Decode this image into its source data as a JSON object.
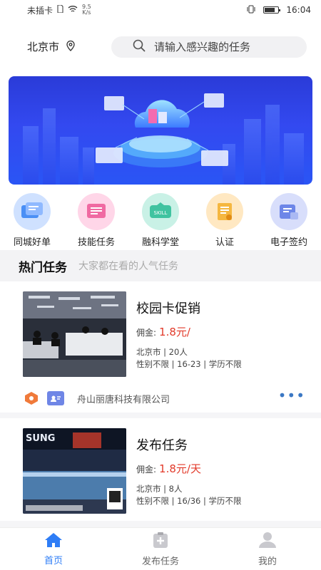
{
  "status_bar": {
    "carrier": "未插卡",
    "speed_value": "9.5",
    "speed_unit": "K/s",
    "time": "16:04"
  },
  "header": {
    "city": "北京市",
    "search_placeholder": "请输入感兴趣的任务"
  },
  "categories": [
    {
      "label": "同城好单",
      "icon": "doc-cards-icon",
      "color": "#4a8ff5"
    },
    {
      "label": "技能任务",
      "icon": "skill-doc-icon",
      "color": "#f06aa2"
    },
    {
      "label": "融科学堂",
      "icon": "skill-badge-icon",
      "color": "#3fc3a0"
    },
    {
      "label": "认证",
      "icon": "certificate-icon",
      "color": "#f5b740"
    },
    {
      "label": "电子签约",
      "icon": "esign-icon",
      "color": "#6d86e8"
    }
  ],
  "section": {
    "title": "热门任务",
    "subtitle": "大家都在看的人气任务"
  },
  "tasks": [
    {
      "title": "校园卡促销",
      "pay_label": "佣金:",
      "pay_value": "1.8元/",
      "location_line": "北京市 | 20人",
      "requirement_line": "性别不限 | 16-23 | 学历不限",
      "company": "舟山丽唐科技有限公司"
    },
    {
      "title": "发布任务",
      "pay_label": "佣金:",
      "pay_value": "1.8元/天",
      "location_line": "北京市 | 8人",
      "requirement_line": "性别不限 | 16/36 | 学历不限",
      "image_text": "SUNG"
    }
  ],
  "tabs": [
    {
      "label": "首页",
      "active": true
    },
    {
      "label": "发布任务",
      "active": false
    },
    {
      "label": "我的",
      "active": false
    }
  ],
  "colors": {
    "accent": "#2e7df6",
    "price": "#e23a2a"
  }
}
